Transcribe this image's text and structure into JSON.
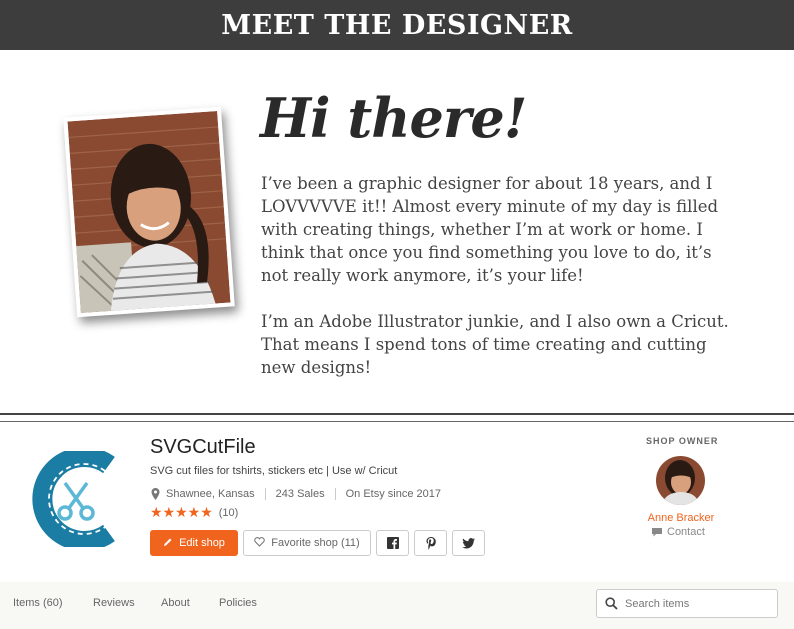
{
  "banner": {
    "title": "MEET THE DESIGNER"
  },
  "intro": {
    "greeting": "Hi there!",
    "paragraph_1": "I’ve been a graphic designer for about 18 years, and I LOVVVVVE it!!  Almost every minute of my day is filled with creating things, whether I’m at work or home.  I think that once you find something you love to do, it’s not really work anymore, it’s your life!",
    "paragraph_2": "I’m an Adobe Illustrator junkie, and I also own a Cricut. That means I spend tons of time creating and cutting new designs!"
  },
  "shop": {
    "name": "SVGCutFile",
    "tagline": "SVG cut files for tshirts, stickers etc | Use w/ Cricut",
    "location": "Shawnee, Kansas",
    "sales": "243 Sales",
    "since": "On Etsy since 2017",
    "rating_stars": 5,
    "review_count": "(10)",
    "buttons": {
      "edit": "Edit shop",
      "favorite": "Favorite shop (11)",
      "facebook_icon": "facebook-icon",
      "pinterest_icon": "pinterest-icon",
      "twitter_icon": "twitter-icon"
    },
    "accent_color": "#f1641e",
    "logo_color": "#1b7da3"
  },
  "owner": {
    "label": "SHOP OWNER",
    "name": "Anne Bracker",
    "contact": "Contact"
  },
  "tabs": [
    "Items (60)",
    "Reviews",
    "About",
    "Policies"
  ],
  "search": {
    "placeholder": "Search items"
  }
}
